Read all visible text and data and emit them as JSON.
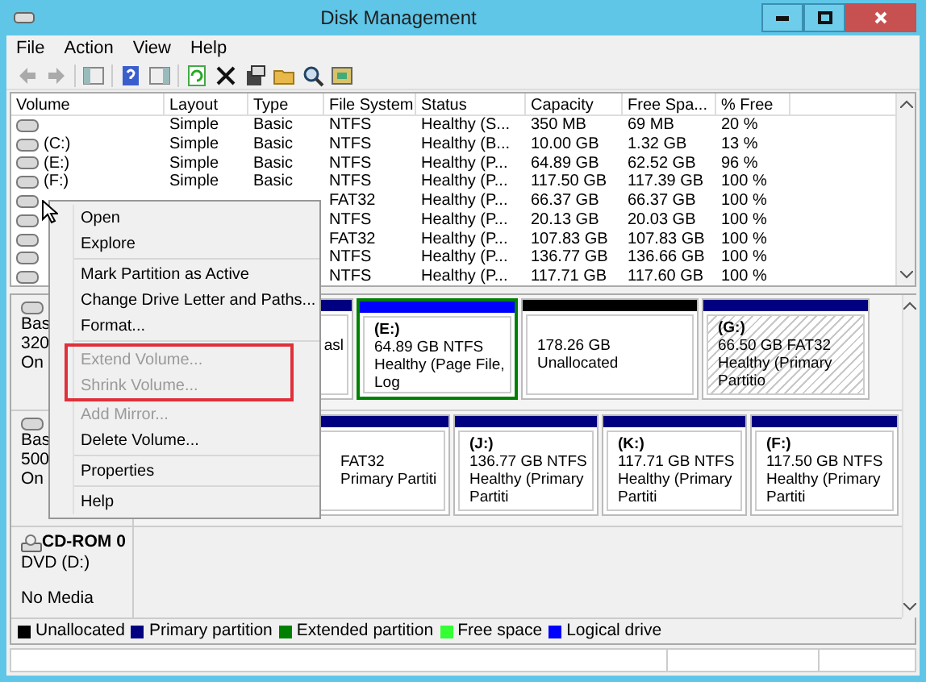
{
  "window": {
    "title": "Disk Management"
  },
  "menu_bar": [
    "File",
    "Action",
    "View",
    "Help"
  ],
  "volume_table": {
    "columns": [
      "Volume",
      "Layout",
      "Type",
      "File System",
      "Status",
      "Capacity",
      "Free Spa...",
      "% Free"
    ],
    "rows": [
      {
        "layout": "Simple",
        "type": "Basic",
        "file_system": "NTFS",
        "status": "Healthy (S...",
        "capacity": "350 MB",
        "free_space": "69 MB",
        "percent_free": "20 %"
      },
      {
        "volume": "(C:)",
        "layout": "Simple",
        "type": "Basic",
        "file_system": "NTFS",
        "status": "Healthy (B...",
        "capacity": "10.00 GB",
        "free_space": "1.32 GB",
        "percent_free": "13 %"
      },
      {
        "volume": "(E:)",
        "layout": "Simple",
        "type": "Basic",
        "file_system": "NTFS",
        "status": "Healthy (P...",
        "capacity": "64.89 GB",
        "free_space": "62.52 GB",
        "percent_free": "96 %"
      },
      {
        "volume": "(F:)",
        "layout": "Simple",
        "type": "Basic",
        "file_system": "NTFS",
        "status": "Healthy (P...",
        "capacity": "117.50 GB",
        "free_space": "117.39 GB",
        "percent_free": "100 %"
      },
      {
        "file_system": "FAT32",
        "status": "Healthy (P...",
        "capacity": "66.37 GB",
        "free_space": "66.37 GB",
        "percent_free": "100 %"
      },
      {
        "file_system": "NTFS",
        "status": "Healthy (P...",
        "capacity": "20.13 GB",
        "free_space": "20.03 GB",
        "percent_free": "100 %"
      },
      {
        "file_system": "FAT32",
        "status": "Healthy (P...",
        "capacity": "107.83 GB",
        "free_space": "107.83 GB",
        "percent_free": "100 %"
      },
      {
        "file_system": "NTFS",
        "status": "Healthy (P...",
        "capacity": "136.77 GB",
        "free_space": "136.66 GB",
        "percent_free": "100 %"
      },
      {
        "file_system": "NTFS",
        "status": "Healthy (P...",
        "capacity": "117.71 GB",
        "free_space": "117.60 GB",
        "percent_free": "100 %"
      }
    ]
  },
  "disks": [
    {
      "label_lines": [
        "Bas",
        "320",
        "On"
      ],
      "partitions": [
        {
          "kind": "primary",
          "selected": false,
          "status": "asl"
        },
        {
          "kind": "logical",
          "selected": false,
          "name": "(E:)",
          "size": "64.89 GB NTFS",
          "status": "Healthy (Page File, Log"
        },
        {
          "kind": "unallocated",
          "selected": false,
          "size": "178.26 GB",
          "status": "Unallocated"
        },
        {
          "kind": "primary",
          "selected": true,
          "name": "(G:)",
          "size": "66.50 GB FAT32",
          "status": "Healthy (Primary Partitio"
        }
      ]
    },
    {
      "label_lines": [
        "Bas",
        "500",
        "On"
      ],
      "partitions": [
        {
          "kind": "primary",
          "selected": false,
          "size": "FAT32",
          "status": "Primary Partiti"
        },
        {
          "kind": "primary",
          "selected": false,
          "name": "(J:)",
          "size": "136.77 GB NTFS",
          "status": "Healthy (Primary Partiti"
        },
        {
          "kind": "primary",
          "selected": false,
          "name": "(K:)",
          "size": "117.71 GB NTFS",
          "status": "Healthy (Primary Partiti"
        },
        {
          "kind": "primary",
          "selected": false,
          "name": "(F:)",
          "size": "117.50 GB NTFS",
          "status": "Healthy (Primary Partiti"
        }
      ]
    }
  ],
  "cdrom": {
    "name": "CD-ROM 0",
    "drive": "DVD (D:)",
    "media": "No Media"
  },
  "legend": [
    {
      "label": "Unallocated",
      "color": "#000000"
    },
    {
      "label": "Primary partition",
      "color": "#000080"
    },
    {
      "label": "Extended partition",
      "color": "#008000"
    },
    {
      "label": "Free space",
      "color": "#33ff33"
    },
    {
      "label": "Logical drive",
      "color": "#0000ff"
    }
  ],
  "context_menu": {
    "groups": [
      [
        {
          "label": "Open",
          "disabled": false,
          "highlighted": false
        },
        {
          "label": "Explore",
          "disabled": false,
          "highlighted": false
        }
      ],
      [
        {
          "label": "Mark Partition as Active",
          "disabled": false,
          "highlighted": false
        },
        {
          "label": "Change Drive Letter and Paths...",
          "disabled": false,
          "highlighted": false
        },
        {
          "label": "Format...",
          "disabled": false,
          "highlighted": false
        }
      ],
      [
        {
          "label": "Extend Volume...",
          "disabled": true,
          "highlighted": true
        },
        {
          "label": "Shrink Volume...",
          "disabled": true,
          "highlighted": true
        },
        {
          "label": "Add Mirror...",
          "disabled": true,
          "highlighted": false
        },
        {
          "label": "Delete Volume...",
          "disabled": false,
          "highlighted": false
        }
      ],
      [
        {
          "label": "Properties",
          "disabled": false,
          "highlighted": false
        }
      ],
      [
        {
          "label": "Help",
          "disabled": false,
          "highlighted": false
        }
      ]
    ]
  }
}
